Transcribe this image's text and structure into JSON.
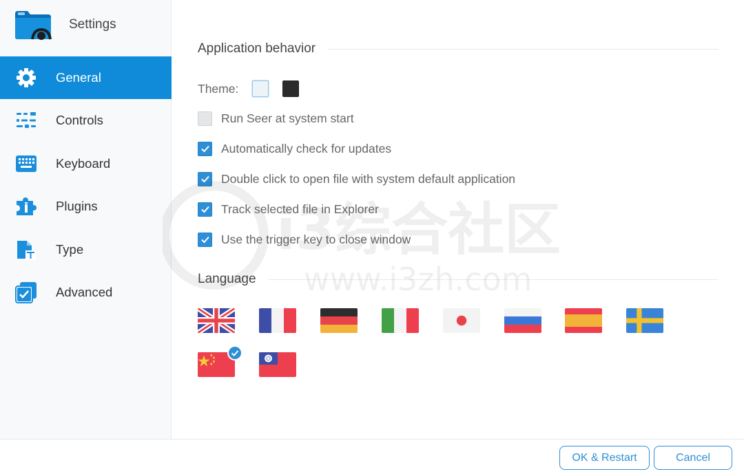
{
  "app": {
    "title": "Settings",
    "icon": "folder-eye-icon",
    "accent_color": "#0f8bd9"
  },
  "sidebar": {
    "items": [
      {
        "label": "General",
        "icon": "gear-icon",
        "active": true
      },
      {
        "label": "Controls",
        "icon": "sliders-icon",
        "active": false
      },
      {
        "label": "Keyboard",
        "icon": "keyboard-icon",
        "active": false
      },
      {
        "label": "Plugins",
        "icon": "puzzle-icon",
        "active": false
      },
      {
        "label": "Type",
        "icon": "file-type-icon",
        "active": false
      },
      {
        "label": "Advanced",
        "icon": "checkbox-stack-icon",
        "active": false
      }
    ]
  },
  "general": {
    "section_title": "Application behavior",
    "theme_label": "Theme:",
    "themes": [
      {
        "name": "light",
        "color": "#eef3f7",
        "selected": true
      },
      {
        "name": "dark",
        "color": "#2b2b2b",
        "selected": false
      }
    ],
    "options": [
      {
        "label": "Run Seer at system start",
        "checked": false
      },
      {
        "label": "Automatically check for updates",
        "checked": true
      },
      {
        "label": "Double click to open file with system default application",
        "checked": true
      },
      {
        "label": "Track selected file in Explorer",
        "checked": true
      },
      {
        "label": "Use the trigger key to close window",
        "checked": true
      }
    ]
  },
  "language": {
    "section_title": "Language",
    "flags": [
      {
        "code": "en",
        "icon": "flag-uk-icon",
        "selected": false
      },
      {
        "code": "fr",
        "icon": "flag-france-icon",
        "selected": false
      },
      {
        "code": "de",
        "icon": "flag-germany-icon",
        "selected": false
      },
      {
        "code": "it",
        "icon": "flag-italy-icon",
        "selected": false
      },
      {
        "code": "ja",
        "icon": "flag-japan-icon",
        "selected": false
      },
      {
        "code": "ru",
        "icon": "flag-russia-icon",
        "selected": false
      },
      {
        "code": "es",
        "icon": "flag-spain-icon",
        "selected": false
      },
      {
        "code": "sv",
        "icon": "flag-sweden-icon",
        "selected": false
      },
      {
        "code": "zh-CN",
        "icon": "flag-china-icon",
        "selected": true
      },
      {
        "code": "zh-TW",
        "icon": "flag-taiwan-icon",
        "selected": false
      }
    ]
  },
  "watermark": {
    "text_main": "i3综合社区",
    "text_url": "www.i3zh.com"
  },
  "footer": {
    "ok_label": "OK & Restart",
    "cancel_label": "Cancel"
  }
}
